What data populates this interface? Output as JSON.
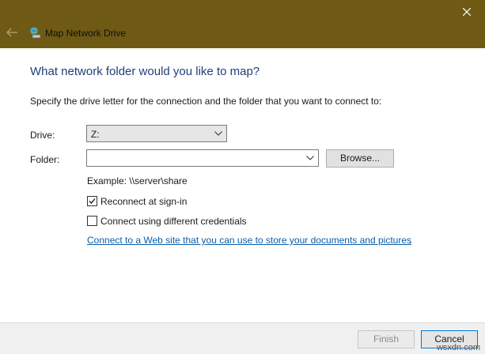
{
  "window": {
    "title": "Map Network Drive",
    "titlebar_color": "#6e5a14"
  },
  "heading": "What network folder would you like to map?",
  "instruction": "Specify the drive letter for the connection and the folder that you want to connect to:",
  "drive": {
    "label": "Drive:",
    "value": "Z:"
  },
  "folder": {
    "label": "Folder:",
    "value": ""
  },
  "browse_label": "Browse...",
  "example": "Example: \\\\server\\share",
  "reconnect": {
    "label": "Reconnect at sign-in",
    "checked": true
  },
  "credentials": {
    "label": "Connect using different credentials",
    "checked": false
  },
  "web_link": {
    "text": "Connect to a Web site that you can use to store your documents and pictures",
    "tail": "."
  },
  "buttons": {
    "finish": "Finish",
    "cancel": "Cancel"
  },
  "watermark": "wsxdn.com",
  "colors": {
    "heading": "#1e3f7a",
    "link": "#0b5ea8",
    "accent": "#0078d7"
  },
  "icons": {
    "back": "back-arrow-icon",
    "app": "network-drive-icon",
    "close": "close-icon"
  }
}
